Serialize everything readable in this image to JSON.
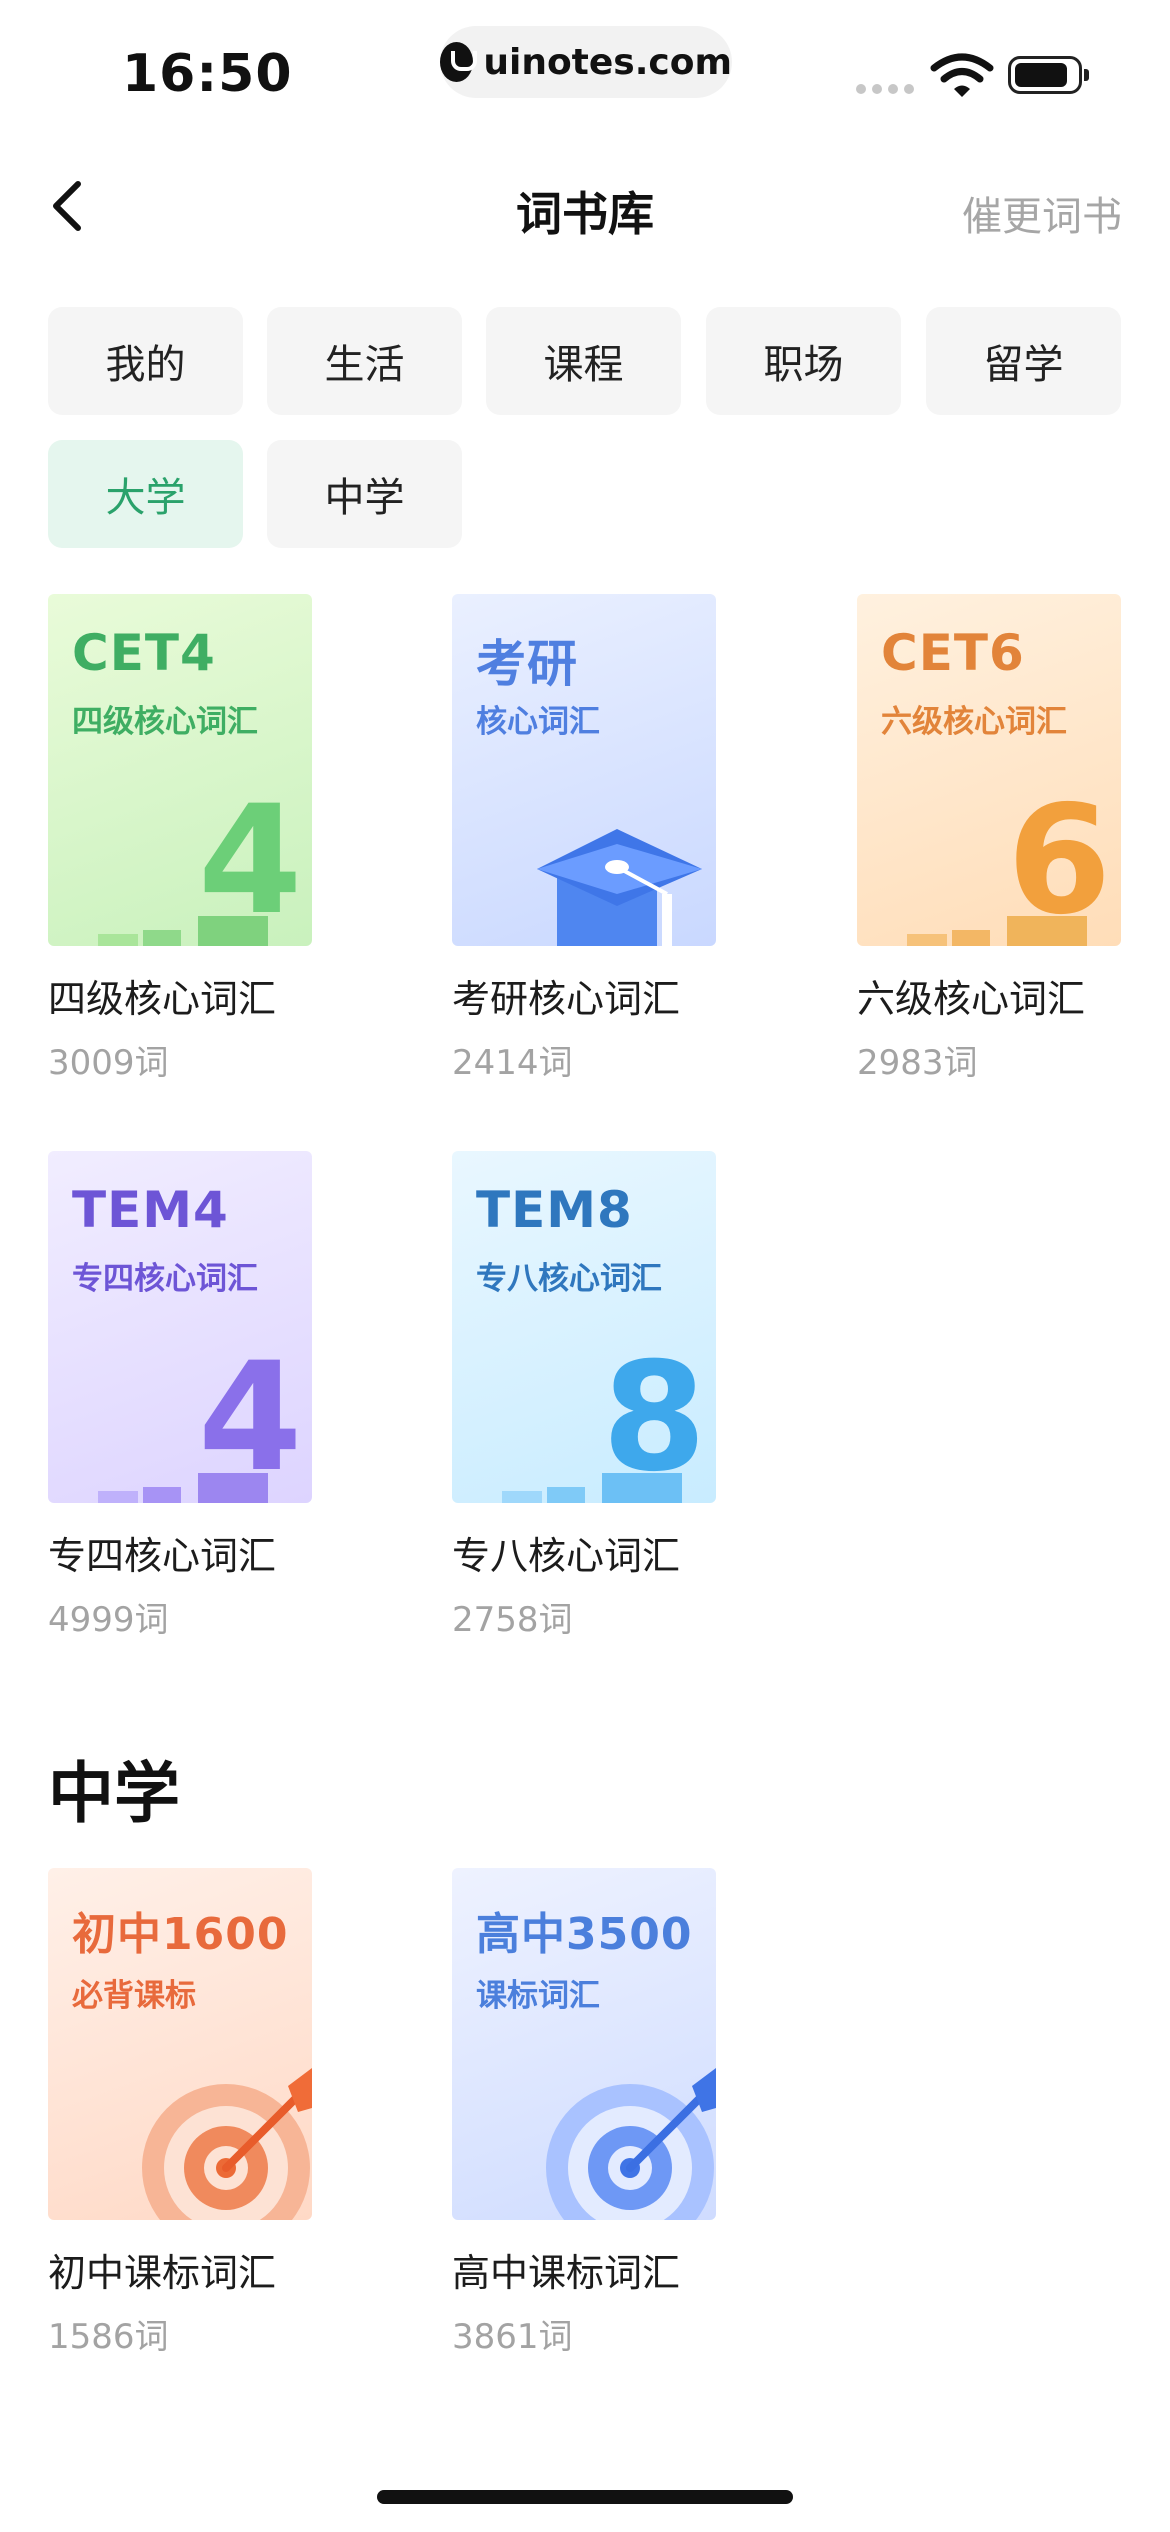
{
  "status": {
    "time": "16:50",
    "url": "uinotes.com"
  },
  "header": {
    "title": "词书库",
    "action": "催更词书"
  },
  "tabs": [
    {
      "label": "我的",
      "active": false
    },
    {
      "label": "生活",
      "active": false
    },
    {
      "label": "课程",
      "active": false
    },
    {
      "label": "职场",
      "active": false
    },
    {
      "label": "留学",
      "active": false
    },
    {
      "label": "大学",
      "active": true
    },
    {
      "label": "中学",
      "active": false
    }
  ],
  "university_books": [
    {
      "cover_title": "CET4",
      "cover_sub": "四级核心词汇",
      "name": "四级核心词汇",
      "count": "3009词",
      "color": "#3fae63",
      "icon": "number-4-podium"
    },
    {
      "cover_title": "考研",
      "cover_sub": "核心词汇",
      "name": "考研核心词汇",
      "count": "2414词",
      "color": "#4f7fe0",
      "icon": "graduation-cap"
    },
    {
      "cover_title": "CET6",
      "cover_sub": "六级核心词汇",
      "name": "六级核心词汇",
      "count": "2983词",
      "color": "#e2843a",
      "icon": "number-6-podium"
    },
    {
      "cover_title": "TEM4",
      "cover_sub": "专四核心词汇",
      "name": "专四核心词汇",
      "count": "4999词",
      "color": "#6d55d6",
      "icon": "number-4-podium"
    },
    {
      "cover_title": "TEM8",
      "cover_sub": "专八核心词汇",
      "name": "专八核心词汇",
      "count": "2758词",
      "color": "#2f77be",
      "icon": "number-8-podium"
    }
  ],
  "middle_section": {
    "title": "中学"
  },
  "middle_books": [
    {
      "cover_title": "初中1600",
      "cover_sub": "必背课标",
      "name": "初中课标词汇",
      "count": "1586词",
      "color": "#e86a3c",
      "icon": "target"
    },
    {
      "cover_title": "高中3500",
      "cover_sub": "课标词汇",
      "name": "高中课标词汇",
      "count": "3861词",
      "color": "#4b7fdc",
      "icon": "target"
    }
  ]
}
